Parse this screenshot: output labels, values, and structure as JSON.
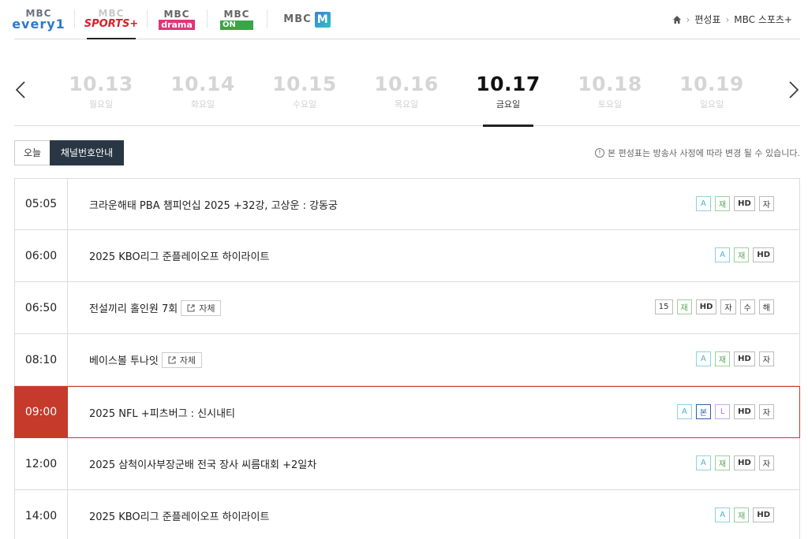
{
  "channels": [
    {
      "id": "every1",
      "line1": "MBC",
      "line2": "every1"
    },
    {
      "id": "sports",
      "line1": "MBC",
      "line2": "SPORTS+"
    },
    {
      "id": "drama",
      "line1": "MBC",
      "line2": "drama"
    },
    {
      "id": "on",
      "line1": "MBC",
      "line2": "ON"
    },
    {
      "id": "m",
      "line1": "MBC",
      "line2": "M"
    }
  ],
  "breadcrumb": {
    "item1": "편성표",
    "item2": "MBC 스포츠+"
  },
  "dates": [
    {
      "date": "10.13",
      "weekday": "월요일"
    },
    {
      "date": "10.14",
      "weekday": "화요일"
    },
    {
      "date": "10.15",
      "weekday": "수요일"
    },
    {
      "date": "10.16",
      "weekday": "목요일"
    },
    {
      "date": "10.17",
      "weekday": "금요일"
    },
    {
      "date": "10.18",
      "weekday": "토요일"
    },
    {
      "date": "10.19",
      "weekday": "일요일"
    }
  ],
  "controls": {
    "today": "오늘",
    "channel_guide": "채널번호안내"
  },
  "notice": "본 편성표는 방송사 사정에 따라 변경 될 수 있습니다.",
  "self_label": "자체",
  "schedule": [
    {
      "time": "05:05",
      "title": "크라운해태 PBA 챔피언십 2025 +32강, 고상운 : 강동궁",
      "badges": [
        "A",
        "재",
        "HD",
        "자"
      ]
    },
    {
      "time": "06:00",
      "title": "2025 KBO리그 준플레이오프 하이라이트",
      "badges": [
        "A",
        "재",
        "HD"
      ]
    },
    {
      "time": "06:50",
      "title": "전설끼리 홀인원 7회",
      "badges": [
        "15",
        "재",
        "HD",
        "자",
        "수",
        "해"
      ]
    },
    {
      "time": "08:10",
      "title": "베이스볼 투나잇",
      "badges": [
        "A",
        "재",
        "HD",
        "자"
      ]
    },
    {
      "time": "09:00",
      "title": "2025 NFL +피츠버그 : 신시내티",
      "badges": [
        "A",
        "본",
        "L",
        "HD",
        "자"
      ]
    },
    {
      "time": "12:00",
      "title": "2025 삼척이사부장군배 전국 장사 씨름대회 +2일차",
      "badges": [
        "A",
        "재",
        "HD",
        "자"
      ]
    },
    {
      "time": "14:00",
      "title": "2025 KBO리그 준플레이오프 하이라이트",
      "badges": [
        "A",
        "재",
        "HD"
      ]
    }
  ]
}
